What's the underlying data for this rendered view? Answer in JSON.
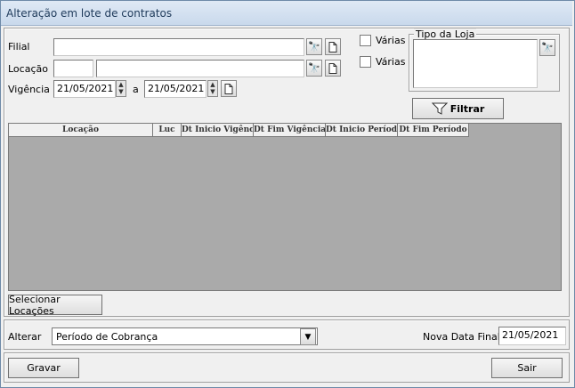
{
  "window": {
    "title": "Alteração em lote de contratos"
  },
  "filters": {
    "filial_label": "Filial",
    "filial_value": "",
    "locacao_label": "Locação",
    "locacao_code": "",
    "locacao_value": "",
    "vigencia_label": "Vigência",
    "vigencia_start": "21/05/2021",
    "vigencia_sep": "a",
    "vigencia_end": "21/05/2021",
    "varias_1": "Várias",
    "varias_2": "Várias",
    "tipo_loja_label": "Tipo da Loja",
    "filtrar_label": "Filtrar"
  },
  "grid": {
    "columns": [
      "Locação",
      "Luc",
      "Dt Inicio Vigência",
      "Dt Fim Vigência",
      "Dt Inicio Período",
      "Dt Fim Período"
    ]
  },
  "selecionar_label": "Selecionar Locações",
  "alterar": {
    "label": "Alterar",
    "selected": "Período de Cobrança",
    "nova_data_label": "Nova Data Final",
    "nova_data_value": "21/05/2021"
  },
  "footer": {
    "gravar_label": "Gravar",
    "sair_label": "Sair"
  }
}
